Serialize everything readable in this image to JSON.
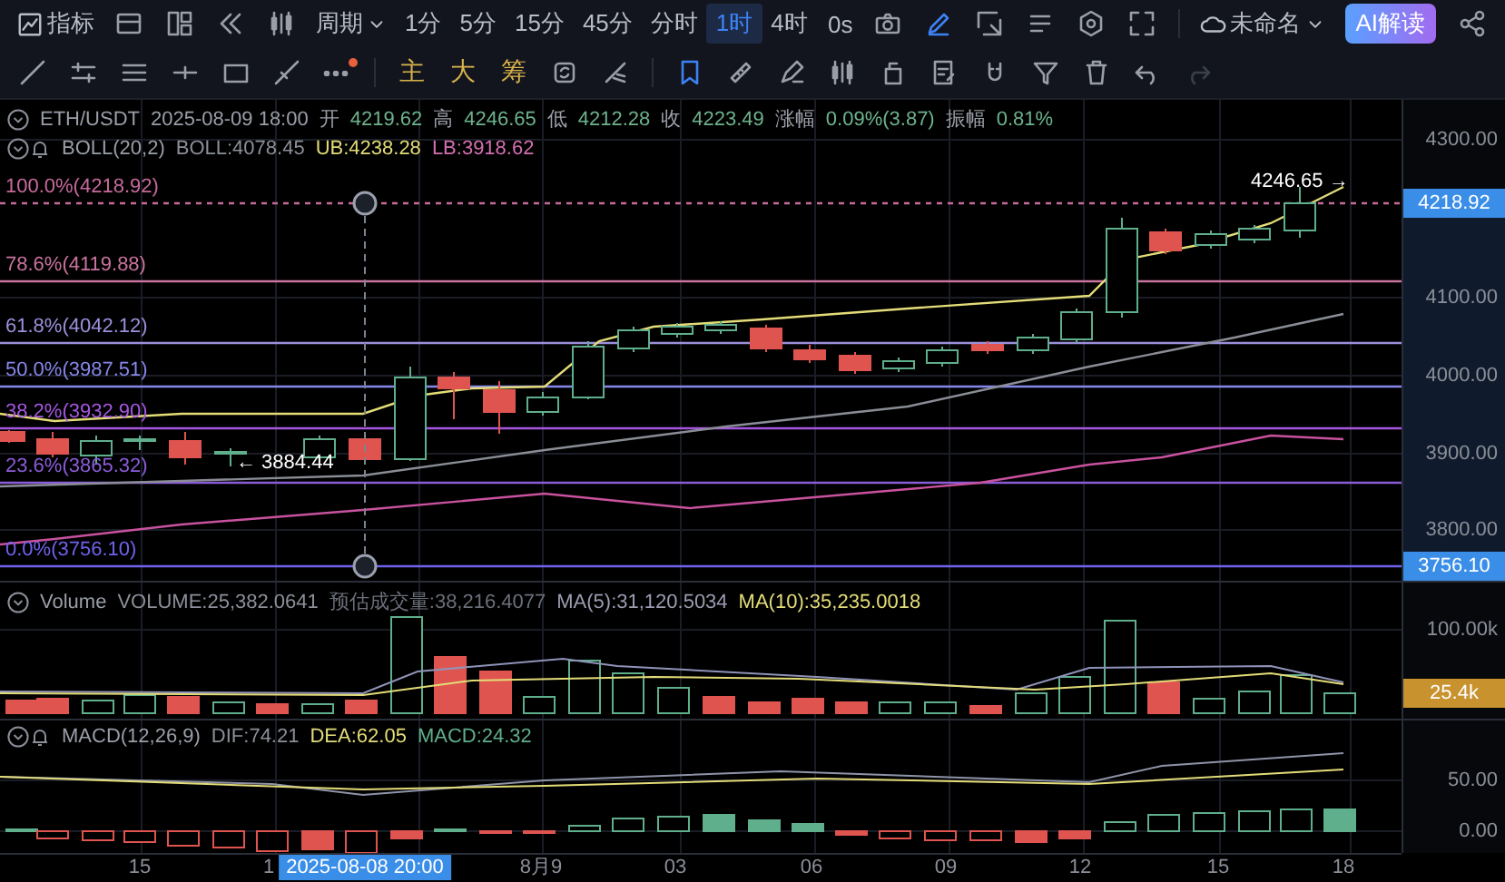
{
  "toolbar": {
    "indicator_label": "指标",
    "period_label": "周期",
    "timeframes": [
      {
        "label": "1分",
        "selected": false
      },
      {
        "label": "5分",
        "selected": false
      },
      {
        "label": "15分",
        "selected": false
      },
      {
        "label": "45分",
        "selected": false
      },
      {
        "label": "分时",
        "selected": false
      },
      {
        "label": "1时",
        "selected": true
      },
      {
        "label": "4时",
        "selected": false
      }
    ],
    "countdown": "0s",
    "draw_mode_on": true,
    "layout_name": "未命名",
    "ai_button": "AI解读"
  },
  "drawing_toolbar": {
    "more_badge": true,
    "quick_labels": [
      "主",
      "大",
      "筹"
    ],
    "bookmark_on": true,
    "redo_disabled": true
  },
  "legend": {
    "symbol": "ETH/USDT",
    "time": "2025-08-09 18:00",
    "quote": [
      {
        "label": "开",
        "value": "4219.62"
      },
      {
        "label": "高",
        "value": "4246.65"
      },
      {
        "label": "低",
        "value": "4212.28"
      },
      {
        "label": "收",
        "value": "4223.49"
      },
      {
        "label": "涨幅",
        "value": "0.09%(3.87)"
      },
      {
        "label": "振幅",
        "value": "0.81%"
      }
    ],
    "boll": {
      "name": "BOLL(20,2)",
      "values": [
        {
          "text": "BOLL:4078.45",
          "color": "#8c8f99"
        },
        {
          "text": "UB:4238.28",
          "color": "#e3dc78"
        },
        {
          "text": "LB:3918.62",
          "color": "#d46fb3"
        }
      ]
    }
  },
  "fibonacci_levels": [
    {
      "label": "100.0%(4218.92)",
      "color": "#c76a9c"
    },
    {
      "label": "78.6%(4119.88)",
      "color": "#c9739f"
    },
    {
      "label": "61.8%(4042.12)",
      "color": "#9d90dc"
    },
    {
      "label": "50.0%(3987.51)",
      "color": "#8686ea"
    },
    {
      "label": "38.2%(3932.90)",
      "color": "#a657e0"
    },
    {
      "label": "23.6%(3865.32)",
      "color": "#8b5cd8"
    },
    {
      "label": "0.0%(3756.10)",
      "color": "#6f62ec"
    }
  ],
  "price_markers": [
    {
      "text": "4246.65 →"
    },
    {
      "text": "← 3884.44"
    }
  ],
  "price_axis": {
    "ticks": [
      "4300.00",
      "4100.00",
      "4000.00",
      "3900.00",
      "3800.00"
    ],
    "badges": [
      "4218.92",
      "3756.10"
    ]
  },
  "volume": {
    "name": "Volume",
    "values": [
      {
        "text": "VOLUME:25,382.0641",
        "color": "#8c8f99"
      },
      {
        "text": "预估成交量:38,216.4077",
        "color": "#6b6f7a"
      },
      {
        "text": "MA(5):31,120.5034",
        "color": "#9a9cb0"
      },
      {
        "text": "MA(10):35,235.0018",
        "color": "#e3dc78"
      }
    ],
    "axis_ticks": [
      "100.00k"
    ],
    "badge": "25.4k"
  },
  "macd": {
    "name": "MACD(12,26,9)",
    "values": [
      {
        "text": "DIF:74.21",
        "color": "#8c8f99"
      },
      {
        "text": "DEA:62.05",
        "color": "#e3dc78"
      },
      {
        "text": "MACD:24.32",
        "color": "#5fae8c"
      }
    ],
    "axis_ticks": [
      "50.00",
      "0.00"
    ]
  },
  "time_axis": {
    "labels": [
      "15",
      "1",
      "8月9",
      "03",
      "06",
      "09",
      "12",
      "15",
      "18"
    ],
    "crosshair_time": "2025-08-08 20:00"
  }
}
